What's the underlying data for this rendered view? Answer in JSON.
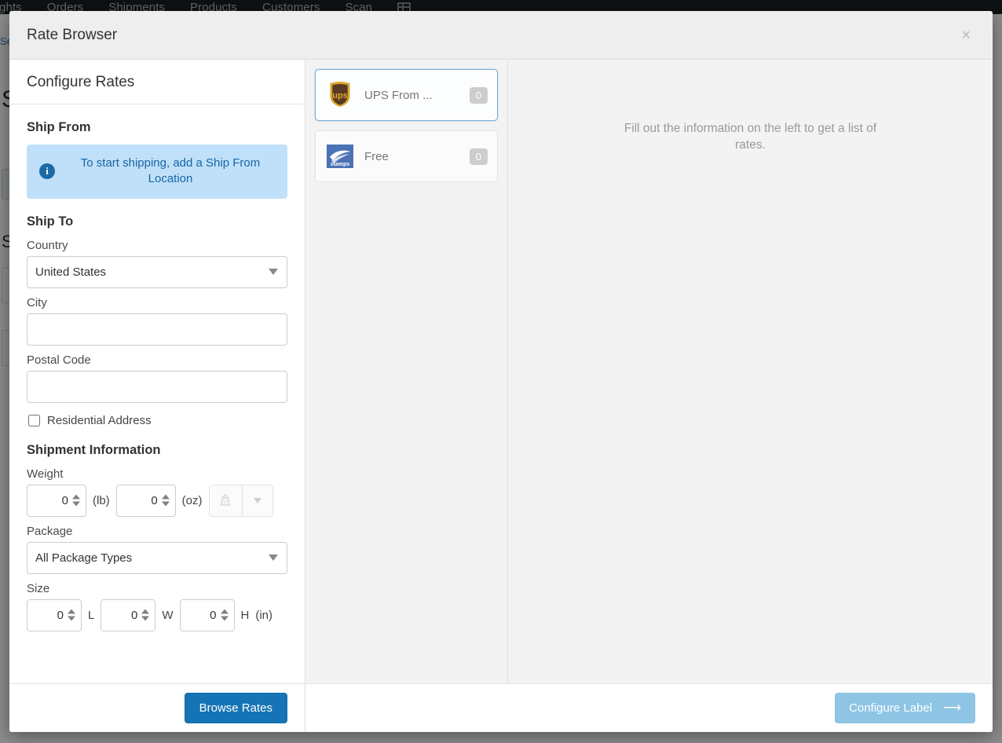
{
  "background": {
    "nav_items": [
      {
        "label": "sights"
      },
      {
        "label": "Orders"
      },
      {
        "label": "Shipments"
      },
      {
        "label": "Products"
      },
      {
        "label": "Customers"
      },
      {
        "label": "Scan"
      }
    ],
    "nav_icon": "grid-icon",
    "link_text": "Se",
    "heading": "S",
    "heading2": "S"
  },
  "modal": {
    "title": "Rate Browser",
    "close_label": "×"
  },
  "configure": {
    "panel_title": "Configure Rates",
    "ship_from": {
      "section_title": "Ship From",
      "alert_icon": "info-icon",
      "alert_text": "To start shipping, add a Ship From Location"
    },
    "ship_to": {
      "section_title": "Ship To",
      "country_label": "Country",
      "country_value": "United States",
      "country_options": [
        "United States"
      ],
      "city_label": "City",
      "city_value": "",
      "city_placeholder": "",
      "postal_label": "Postal Code",
      "postal_value": "",
      "postal_placeholder": "",
      "residential_label": "Residential Address",
      "residential_checked": false
    },
    "shipment": {
      "section_title": "Shipment Information",
      "weight_label": "Weight",
      "weight_lb_value": "0",
      "weight_lb_unit": "(lb)",
      "weight_oz_value": "0",
      "weight_oz_unit": "(oz)",
      "scale_icon": "scale-weight-icon",
      "scale_caret_icon": "chevron-down-icon",
      "package_label": "Package",
      "package_value": "All Package Types",
      "package_options": [
        "All Package Types"
      ],
      "size_label": "Size",
      "size_length_value": "0",
      "size_length_unit": "L",
      "size_width_value": "0",
      "size_width_unit": "W",
      "size_height_value": "0",
      "size_height_unit": "H",
      "size_unit": "(in)"
    }
  },
  "carriers": [
    {
      "name": "UPS From ...",
      "badge": "0",
      "logo": "ups-logo",
      "selected": true
    },
    {
      "name": "Free",
      "badge": "0",
      "logo": "stamps-logo",
      "selected": false
    }
  ],
  "results": {
    "empty_message": "Fill out the information on the left to get a list of rates."
  },
  "footer": {
    "browse_rates_label": "Browse Rates",
    "configure_label_label": "Configure Label",
    "configure_label_icon": "arrow-right-icon"
  },
  "colors": {
    "primary": "#1574b5",
    "primary_disabled": "#8ec4e4",
    "alert_bg": "#bfe0f8",
    "alert_text": "#1767a8",
    "selected_border": "#7ab0d6"
  }
}
